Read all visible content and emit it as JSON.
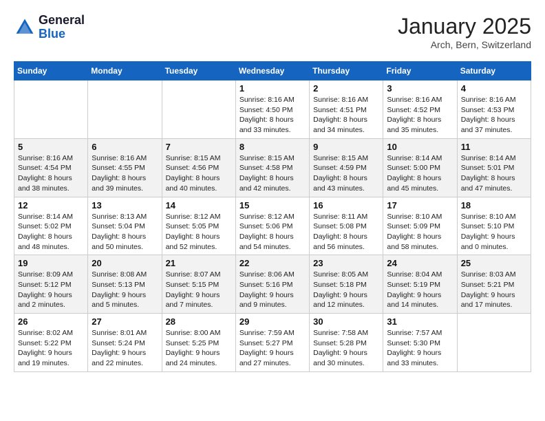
{
  "header": {
    "logo_general": "General",
    "logo_blue": "Blue",
    "month": "January 2025",
    "location": "Arch, Bern, Switzerland"
  },
  "weekdays": [
    "Sunday",
    "Monday",
    "Tuesday",
    "Wednesday",
    "Thursday",
    "Friday",
    "Saturday"
  ],
  "weeks": [
    [
      {
        "day": "",
        "info": ""
      },
      {
        "day": "",
        "info": ""
      },
      {
        "day": "",
        "info": ""
      },
      {
        "day": "1",
        "info": "Sunrise: 8:16 AM\nSunset: 4:50 PM\nDaylight: 8 hours\nand 33 minutes."
      },
      {
        "day": "2",
        "info": "Sunrise: 8:16 AM\nSunset: 4:51 PM\nDaylight: 8 hours\nand 34 minutes."
      },
      {
        "day": "3",
        "info": "Sunrise: 8:16 AM\nSunset: 4:52 PM\nDaylight: 8 hours\nand 35 minutes."
      },
      {
        "day": "4",
        "info": "Sunrise: 8:16 AM\nSunset: 4:53 PM\nDaylight: 8 hours\nand 37 minutes."
      }
    ],
    [
      {
        "day": "5",
        "info": "Sunrise: 8:16 AM\nSunset: 4:54 PM\nDaylight: 8 hours\nand 38 minutes."
      },
      {
        "day": "6",
        "info": "Sunrise: 8:16 AM\nSunset: 4:55 PM\nDaylight: 8 hours\nand 39 minutes."
      },
      {
        "day": "7",
        "info": "Sunrise: 8:15 AM\nSunset: 4:56 PM\nDaylight: 8 hours\nand 40 minutes."
      },
      {
        "day": "8",
        "info": "Sunrise: 8:15 AM\nSunset: 4:58 PM\nDaylight: 8 hours\nand 42 minutes."
      },
      {
        "day": "9",
        "info": "Sunrise: 8:15 AM\nSunset: 4:59 PM\nDaylight: 8 hours\nand 43 minutes."
      },
      {
        "day": "10",
        "info": "Sunrise: 8:14 AM\nSunset: 5:00 PM\nDaylight: 8 hours\nand 45 minutes."
      },
      {
        "day": "11",
        "info": "Sunrise: 8:14 AM\nSunset: 5:01 PM\nDaylight: 8 hours\nand 47 minutes."
      }
    ],
    [
      {
        "day": "12",
        "info": "Sunrise: 8:14 AM\nSunset: 5:02 PM\nDaylight: 8 hours\nand 48 minutes."
      },
      {
        "day": "13",
        "info": "Sunrise: 8:13 AM\nSunset: 5:04 PM\nDaylight: 8 hours\nand 50 minutes."
      },
      {
        "day": "14",
        "info": "Sunrise: 8:12 AM\nSunset: 5:05 PM\nDaylight: 8 hours\nand 52 minutes."
      },
      {
        "day": "15",
        "info": "Sunrise: 8:12 AM\nSunset: 5:06 PM\nDaylight: 8 hours\nand 54 minutes."
      },
      {
        "day": "16",
        "info": "Sunrise: 8:11 AM\nSunset: 5:08 PM\nDaylight: 8 hours\nand 56 minutes."
      },
      {
        "day": "17",
        "info": "Sunrise: 8:10 AM\nSunset: 5:09 PM\nDaylight: 8 hours\nand 58 minutes."
      },
      {
        "day": "18",
        "info": "Sunrise: 8:10 AM\nSunset: 5:10 PM\nDaylight: 9 hours\nand 0 minutes."
      }
    ],
    [
      {
        "day": "19",
        "info": "Sunrise: 8:09 AM\nSunset: 5:12 PM\nDaylight: 9 hours\nand 2 minutes."
      },
      {
        "day": "20",
        "info": "Sunrise: 8:08 AM\nSunset: 5:13 PM\nDaylight: 9 hours\nand 5 minutes."
      },
      {
        "day": "21",
        "info": "Sunrise: 8:07 AM\nSunset: 5:15 PM\nDaylight: 9 hours\nand 7 minutes."
      },
      {
        "day": "22",
        "info": "Sunrise: 8:06 AM\nSunset: 5:16 PM\nDaylight: 9 hours\nand 9 minutes."
      },
      {
        "day": "23",
        "info": "Sunrise: 8:05 AM\nSunset: 5:18 PM\nDaylight: 9 hours\nand 12 minutes."
      },
      {
        "day": "24",
        "info": "Sunrise: 8:04 AM\nSunset: 5:19 PM\nDaylight: 9 hours\nand 14 minutes."
      },
      {
        "day": "25",
        "info": "Sunrise: 8:03 AM\nSunset: 5:21 PM\nDaylight: 9 hours\nand 17 minutes."
      }
    ],
    [
      {
        "day": "26",
        "info": "Sunrise: 8:02 AM\nSunset: 5:22 PM\nDaylight: 9 hours\nand 19 minutes."
      },
      {
        "day": "27",
        "info": "Sunrise: 8:01 AM\nSunset: 5:24 PM\nDaylight: 9 hours\nand 22 minutes."
      },
      {
        "day": "28",
        "info": "Sunrise: 8:00 AM\nSunset: 5:25 PM\nDaylight: 9 hours\nand 24 minutes."
      },
      {
        "day": "29",
        "info": "Sunrise: 7:59 AM\nSunset: 5:27 PM\nDaylight: 9 hours\nand 27 minutes."
      },
      {
        "day": "30",
        "info": "Sunrise: 7:58 AM\nSunset: 5:28 PM\nDaylight: 9 hours\nand 30 minutes."
      },
      {
        "day": "31",
        "info": "Sunrise: 7:57 AM\nSunset: 5:30 PM\nDaylight: 9 hours\nand 33 minutes."
      },
      {
        "day": "",
        "info": ""
      }
    ]
  ]
}
